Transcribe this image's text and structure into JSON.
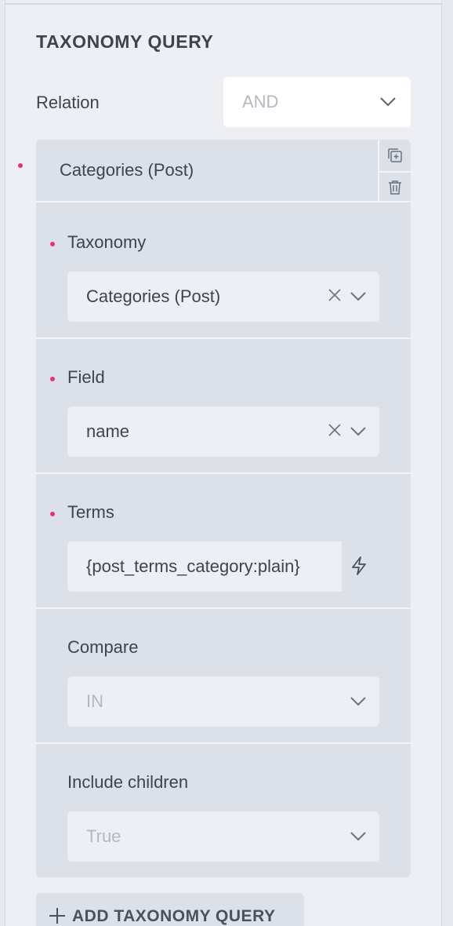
{
  "section": {
    "title": "TAXONOMY QUERY"
  },
  "relation": {
    "label": "Relation",
    "value": "AND"
  },
  "group": {
    "title": "Categories (Post)",
    "actions": {
      "duplicate_icon": "duplicate-icon",
      "delete_icon": "trash-icon"
    }
  },
  "fields": {
    "taxonomy": {
      "label": "Taxonomy",
      "value": "Categories (Post)",
      "required": true
    },
    "field": {
      "label": "Field",
      "value": "name",
      "required": true
    },
    "terms": {
      "label": "Terms",
      "value": "{post_terms_category:plain}",
      "required": true,
      "dynamic_icon": "bolt-icon"
    },
    "compare": {
      "label": "Compare",
      "value": "IN",
      "required": false
    },
    "include_children": {
      "label": "Include children",
      "value": "True",
      "required": false
    }
  },
  "add_button": {
    "label": "ADD TAXONOMY QUERY",
    "icon": "plus-icon"
  },
  "colors": {
    "required_dot": "#e6317c",
    "panel_bg": "#edeff4",
    "group_bg": "#dce1e9",
    "text": "#3d4450",
    "placeholder": "#b3b8c2"
  }
}
